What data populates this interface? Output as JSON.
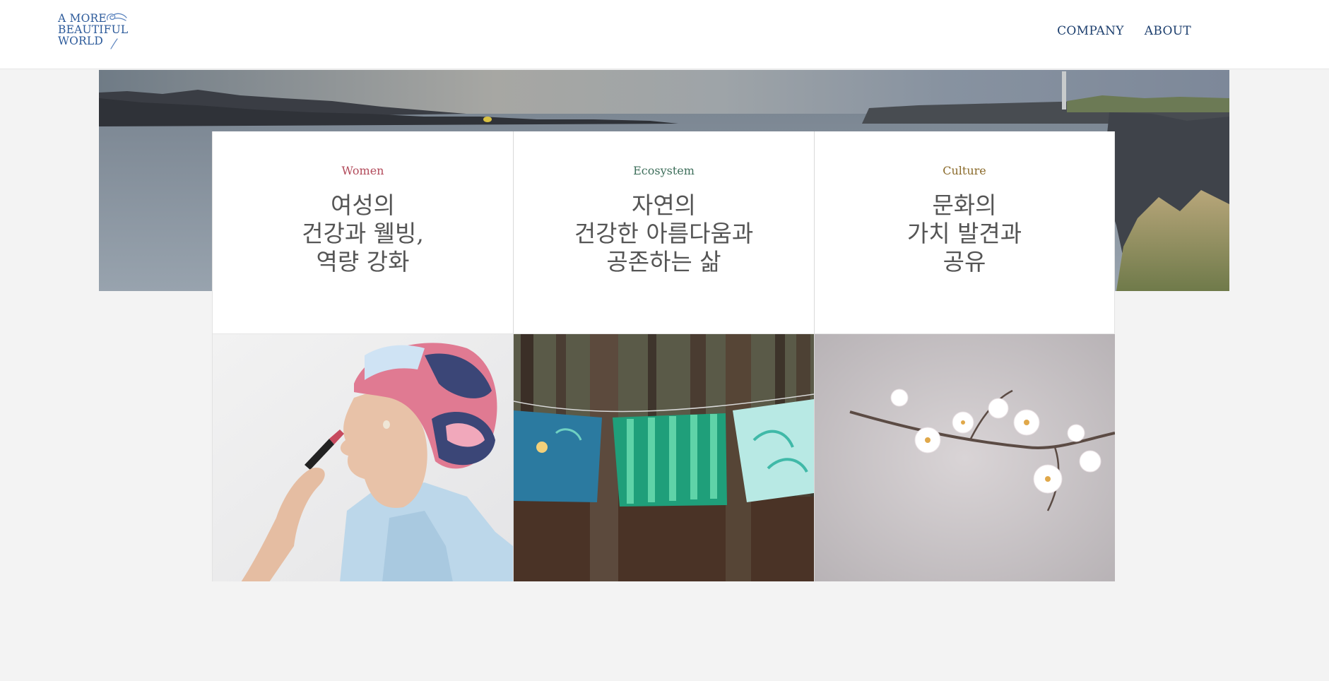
{
  "brand": {
    "logo_lines": [
      "A MORE",
      "BEAUTIFUL",
      "WORLD"
    ],
    "color": "#2c5a9a"
  },
  "nav": {
    "items": [
      {
        "label": "COMPANY"
      },
      {
        "label": "ABOUT"
      }
    ]
  },
  "hero": {
    "image": "coastal-rock-landscape"
  },
  "cards": [
    {
      "category": "Women",
      "category_color": "#b24a5a",
      "title_lines": [
        "여성의",
        "건강과 웰빙,",
        "역량 강화"
      ],
      "image": "woman-applying-lipstick-headscarf"
    },
    {
      "category": "Ecosystem",
      "category_color": "#3d6e5a",
      "title_lines": [
        "자연의",
        "건강한 아름다움과",
        "공존하는 삶"
      ],
      "image": "forest-hanging-fabrics"
    },
    {
      "category": "Culture",
      "category_color": "#8a6a2a",
      "title_lines": [
        "문화의",
        "가치 발견과",
        "공유"
      ],
      "image": "plum-blossom-branch"
    }
  ]
}
